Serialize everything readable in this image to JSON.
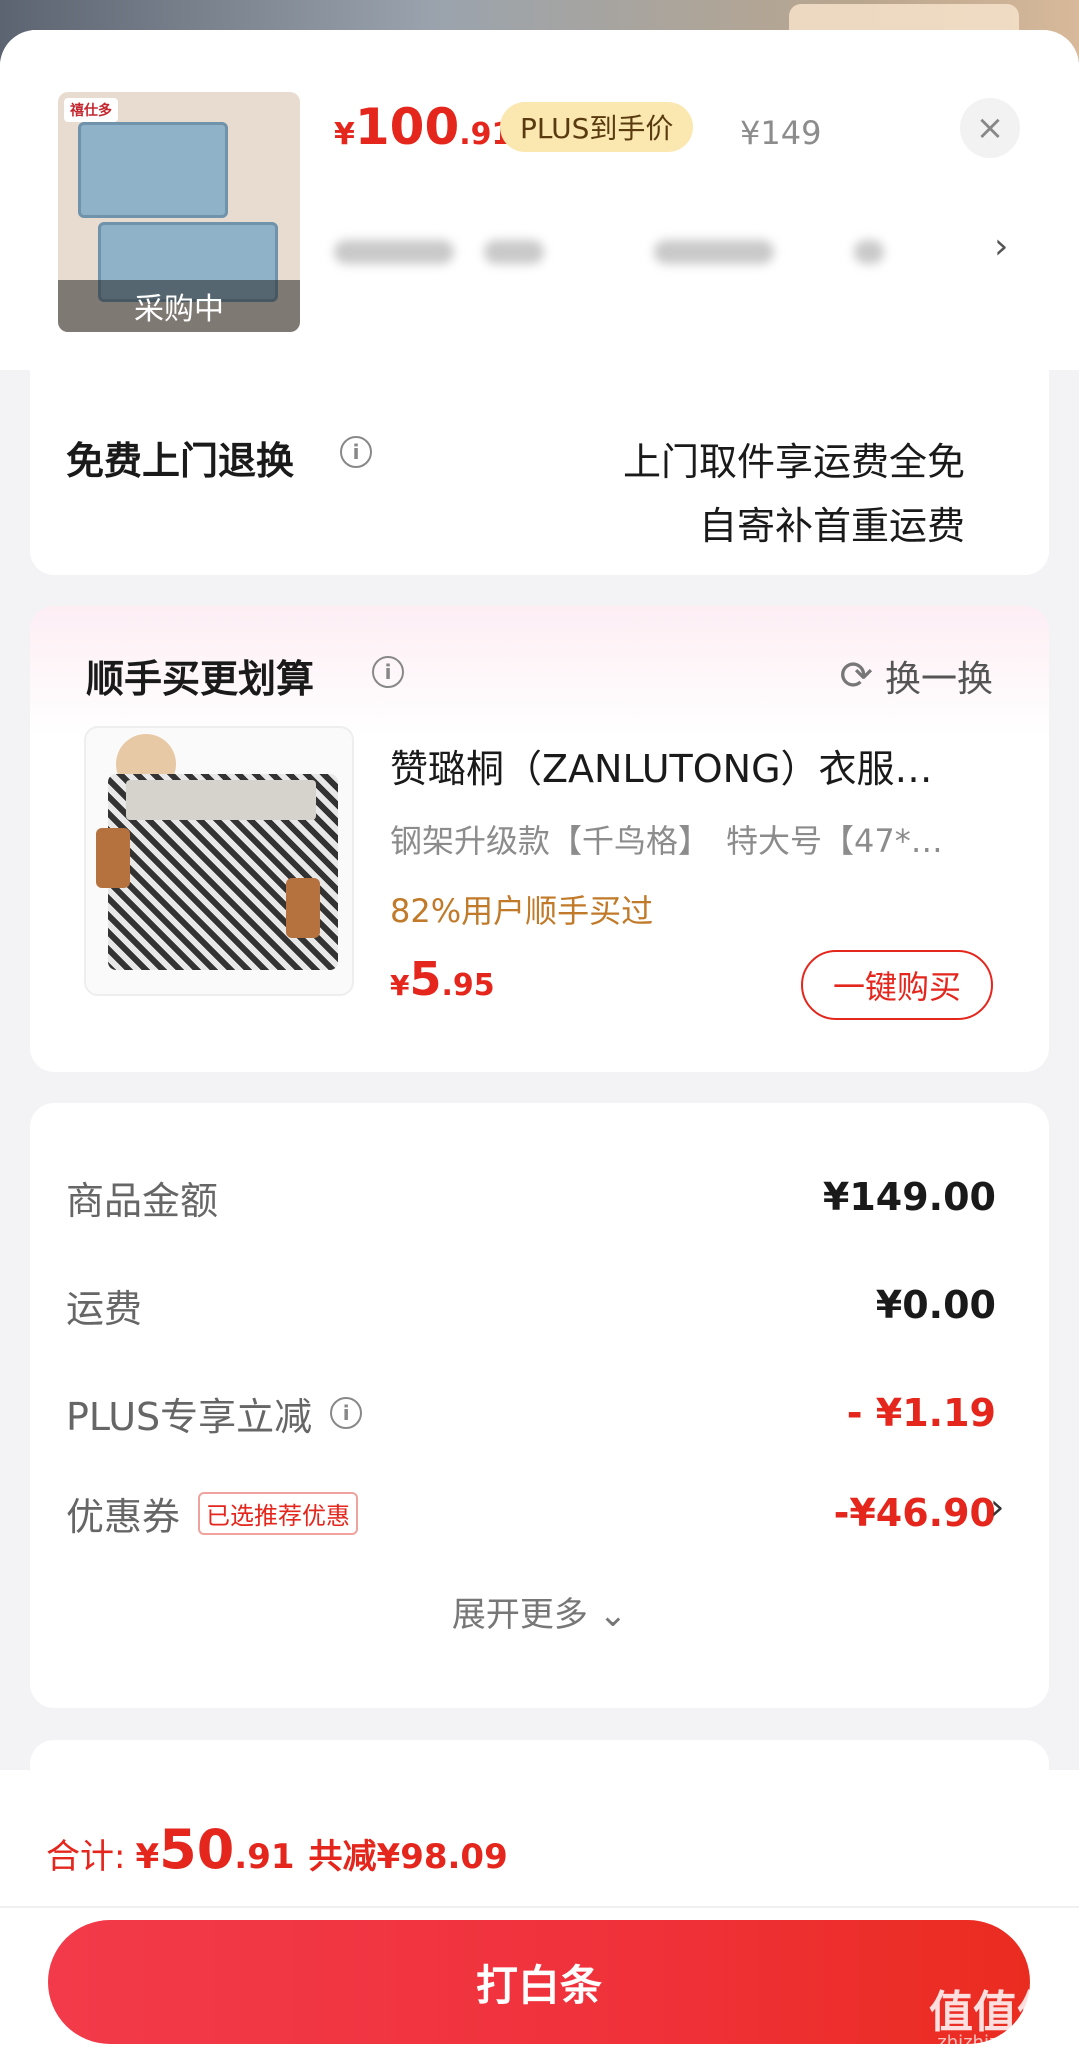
{
  "product": {
    "thumb_brand": "禧仕多",
    "thumb_overlay": "采购中",
    "price_currency": "¥",
    "price_integer": "100",
    "price_decimal": ".91",
    "plus_badge": "PLUS到手价",
    "original_price": "¥149",
    "close_icon": "×",
    "spec_arrow": "›"
  },
  "return_service": {
    "title": "免费上门退换",
    "line1": "上门取件享运费全免",
    "line2": "自寄补首重运费"
  },
  "bundle": {
    "title": "顺手买更划算",
    "swap_label": "换一换",
    "item_name": "赞璐桐（ZANLUTONG）衣服…",
    "item_spec": "钢架升级款【千鸟格】　特大号【47*…",
    "social_proof": "82%用户顺手买过",
    "price_currency": "¥",
    "price_integer": "5",
    "price_decimal": ".95",
    "buy_button": "一键购买"
  },
  "amounts": {
    "goods_label": "商品金额",
    "goods_value": "¥149.00",
    "shipping_label": "运费",
    "shipping_value": "¥0.00",
    "plus_label": "PLUS专享立减",
    "plus_value": "- ¥1.19",
    "coupon_label": "优惠券",
    "coupon_tag": "已选推荐优惠",
    "coupon_value": "-¥46.90",
    "expand_label": "展开更多",
    "expand_icon": "⌄"
  },
  "footer": {
    "total_label": "合计:",
    "total_currency": "¥",
    "total_integer": "50",
    "total_decimal": ".91",
    "total_saving": "共减¥98.09",
    "pay_button": "打白条",
    "watermark": "值值值",
    "watermark_sub": "zhizhizhi.com"
  },
  "colors": {
    "accent": "#e4261d",
    "plus_gold": "#fbe7b0",
    "social_orange": "#c17a2a"
  }
}
